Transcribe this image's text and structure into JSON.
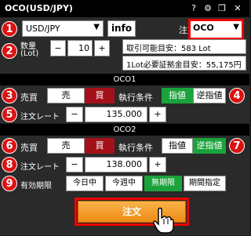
{
  "window": {
    "title": "OCO(USD/JPY)"
  },
  "titlebar_icons": [
    "help-icon",
    "gear-icon",
    "restore-icon",
    "close-icon"
  ],
  "titlebar_glyphs": {
    "help": "?",
    "gear": "⚙",
    "restore": "❐",
    "close": "✕"
  },
  "markers": [
    "1",
    "2",
    "3",
    "4",
    "5",
    "6",
    "7",
    "8",
    "9"
  ],
  "symbol": {
    "value": "USD/JPY",
    "info_label": "info"
  },
  "order_type": {
    "label": "注文タイプ",
    "value": "OCO"
  },
  "quantity": {
    "label_line1": "数量",
    "label_line2": "(Lot)",
    "minus": "−",
    "plus": "+",
    "value": "10",
    "max_order_text": "取引可能目安：583 Lot",
    "margin_text": "1Lot必要証拠金目安：55,175円"
  },
  "oco1": {
    "header": "OCO1",
    "side_label": "売買",
    "sell": "売",
    "buy": "買",
    "exec_label": "執行条件",
    "limit": "指値",
    "stop": "逆指値",
    "rate_label": "注文レート",
    "minus": "−",
    "plus": "+",
    "rate": "135.000"
  },
  "oco2": {
    "header": "OCO2",
    "side_label": "売買",
    "sell": "売",
    "buy": "買",
    "exec_label": "執行条件",
    "limit": "指値",
    "stop": "逆指値",
    "rate_label": "注文レート",
    "minus": "−",
    "plus": "+",
    "rate": "138.000"
  },
  "expiry": {
    "label": "有効期限",
    "options": [
      "今日中",
      "今週中",
      "無期限",
      "期間指定"
    ],
    "selected": "無期限"
  },
  "submit": {
    "label": "注文"
  },
  "colors": {
    "accent_red": "#a4101a",
    "accent_green": "#1aa33a",
    "marker_red": "#dd1111",
    "order_orange": "#f0951e"
  }
}
